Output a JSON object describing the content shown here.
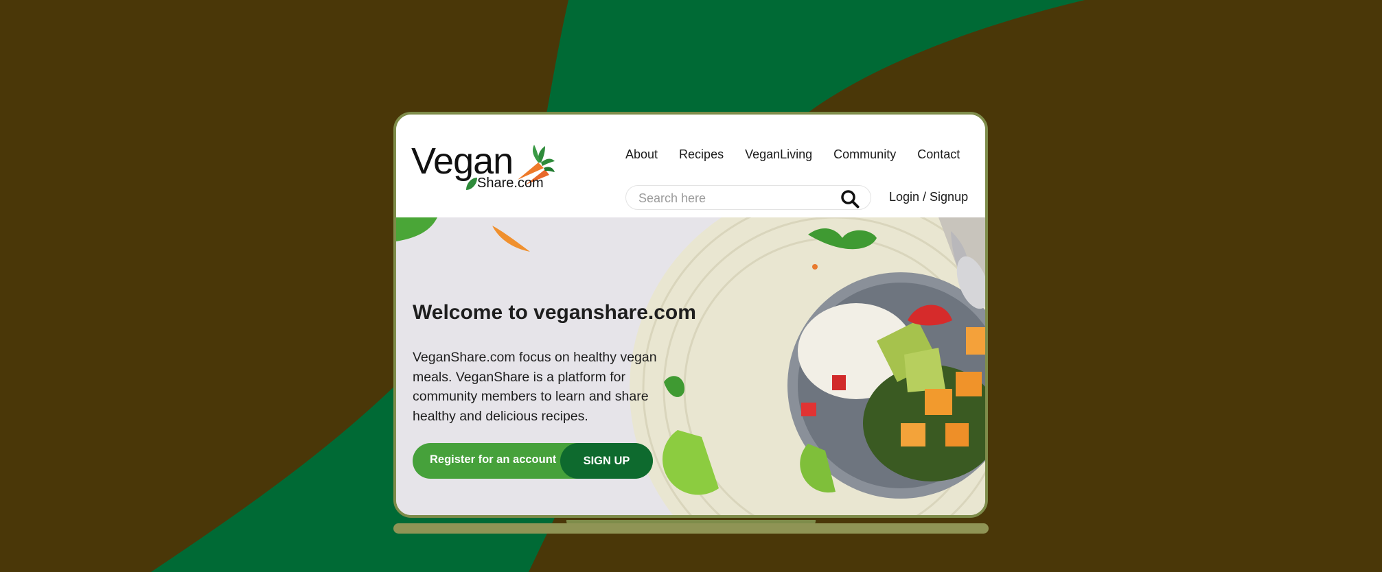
{
  "brand": {
    "name": "Vegan",
    "sub": "Share.com"
  },
  "nav": {
    "items": [
      "About",
      "Recipes",
      "VeganLiving",
      "Community",
      "Contact"
    ]
  },
  "search": {
    "placeholder": "Search here"
  },
  "auth": {
    "login_label": "Login / Signup"
  },
  "hero": {
    "title": "Welcome to veganshare.com",
    "text": "VeganShare.com focus on healthy vegan meals. VeganShare is a platform for community members to learn and share healthy and delicious recipes.",
    "cta_label": "Register for an account",
    "cta_button": "SIGN UP"
  },
  "colors": {
    "background": "#4a3708",
    "wave_green": "#006a35",
    "cta_light": "#46a13b",
    "cta_dark": "#0e6a2e",
    "frame": "#7e8c4a"
  }
}
